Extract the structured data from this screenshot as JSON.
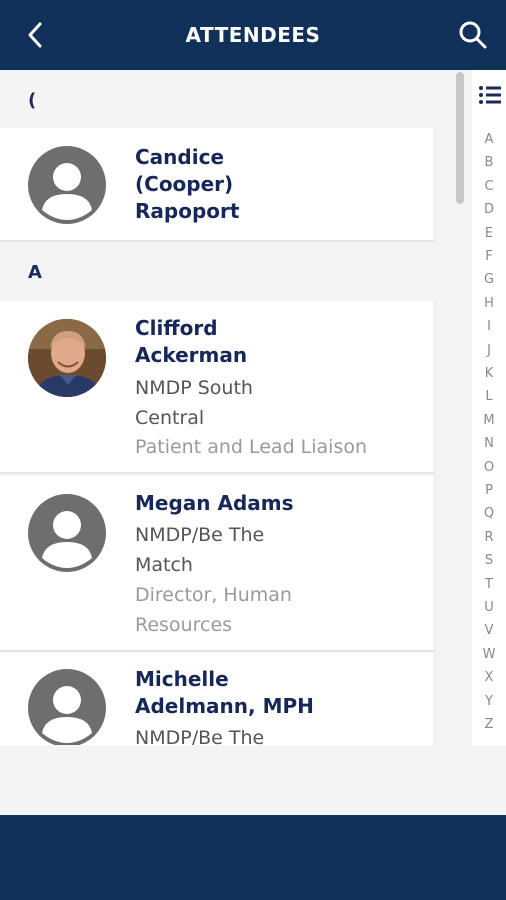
{
  "header": {
    "title": "ATTENDEES",
    "back_icon": "chevron-left-icon",
    "search_icon": "search-icon"
  },
  "sections": [
    {
      "letter": "(",
      "attendees": [
        {
          "name": "Candice (Cooper) Rapoport",
          "name_lines": [
            "Candice",
            "(Cooper)",
            "Rapoport"
          ],
          "organization": "",
          "position": "",
          "avatar": "placeholder"
        }
      ]
    },
    {
      "letter": "A",
      "attendees": [
        {
          "name": "Clifford Ackerman",
          "name_lines": [
            "Clifford",
            "Ackerman"
          ],
          "organization_lines": [
            "NMDP South",
            "Central"
          ],
          "position_lines": [
            "Patient and Lead Liaison"
          ],
          "avatar": "photo"
        },
        {
          "name": "Megan Adams",
          "name_lines": [
            "Megan Adams"
          ],
          "organization_lines": [
            "NMDP/Be The",
            "Match"
          ],
          "position_lines": [
            "Director, Human",
            "Resources"
          ],
          "avatar": "placeholder"
        },
        {
          "name": "Michelle Adelmann, MPH",
          "name_lines": [
            "Michelle",
            "Adelmann, MPH"
          ],
          "organization_lines": [
            "NMDP/Be The"
          ],
          "position_lines": [],
          "avatar": "placeholder"
        }
      ]
    }
  ],
  "index": {
    "list_icon": "list-icon",
    "letters": [
      "A",
      "B",
      "C",
      "D",
      "E",
      "F",
      "G",
      "H",
      "I",
      "J",
      "K",
      "L",
      "M",
      "N",
      "O",
      "P",
      "Q",
      "R",
      "S",
      "T",
      "U",
      "V",
      "W",
      "X",
      "Y",
      "Z"
    ]
  },
  "colors": {
    "header_bg": "#11305a",
    "name_color": "#16285a",
    "avatar_placeholder": "#6e6e6e"
  }
}
